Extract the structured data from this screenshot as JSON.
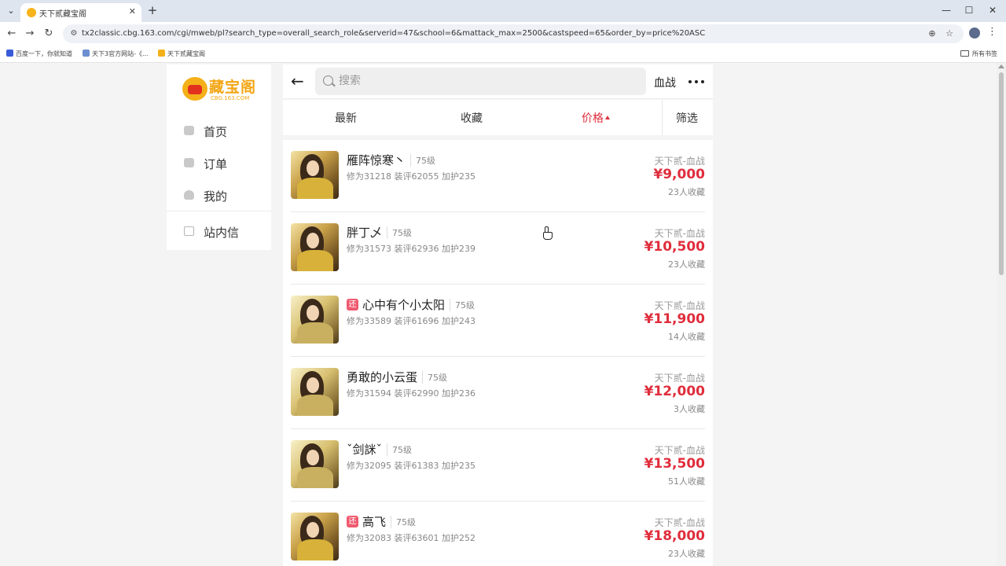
{
  "browser": {
    "tab_title": "天下贰藏宝阁",
    "close": "✕",
    "new_tab": "+",
    "url": "tx2classic.cbg.163.com/cgi/mweb/pl?search_type=overall_search_role&serverid=47&school=6&mattack_max=2500&castspeed=65&order_by=price%20ASC",
    "bookmarks": [
      "百度一下，你就知道",
      "天下3官方网站-《...",
      "天下贰藏宝阁"
    ],
    "bookmarks_folder": "所有书签"
  },
  "sidebar": {
    "logo_text": "藏宝阁",
    "logo_sub": "CBG.163.COM",
    "items": [
      "首页",
      "订单",
      "我的",
      "站内信"
    ]
  },
  "header": {
    "search_placeholder": "搜索",
    "server": "血战"
  },
  "sort_tabs": [
    "最新",
    "收藏",
    "价格",
    "筛选"
  ],
  "accent_color": "#e02d3c",
  "badge_return": "还",
  "items": [
    {
      "name": "雁阵惊寒丶",
      "level": "75级",
      "stats": "修为31218 装评62055 加护235",
      "server": "天下贰-血战",
      "price": "¥9,000",
      "fav": "23人收藏",
      "returned": false
    },
    {
      "name": "胖丁乄",
      "level": "75级",
      "stats": "修为31573 装评62936 加护239",
      "server": "天下贰-血战",
      "price": "¥10,500",
      "fav": "23人收藏",
      "returned": false
    },
    {
      "name": "心中有个小太阳",
      "level": "75级",
      "stats": "修为33589 装评61696 加护243",
      "server": "天下贰-血战",
      "price": "¥11,900",
      "fav": "14人收藏",
      "returned": true
    },
    {
      "name": "勇敢的小云蛋",
      "level": "75级",
      "stats": "修为31594 装评62990 加护236",
      "server": "天下贰-血战",
      "price": "¥12,000",
      "fav": "3人收藏",
      "returned": false
    },
    {
      "name": "ˇ剑詸ˇ",
      "level": "75级",
      "stats": "修为32095 装评61383 加护235",
      "server": "天下贰-血战",
      "price": "¥13,500",
      "fav": "51人收藏",
      "returned": false
    },
    {
      "name": "高飞",
      "level": "75级",
      "stats": "修为32083 装评63601 加护252",
      "server": "天下贰-血战",
      "price": "¥18,000",
      "fav": "23人收藏",
      "returned": true
    }
  ]
}
